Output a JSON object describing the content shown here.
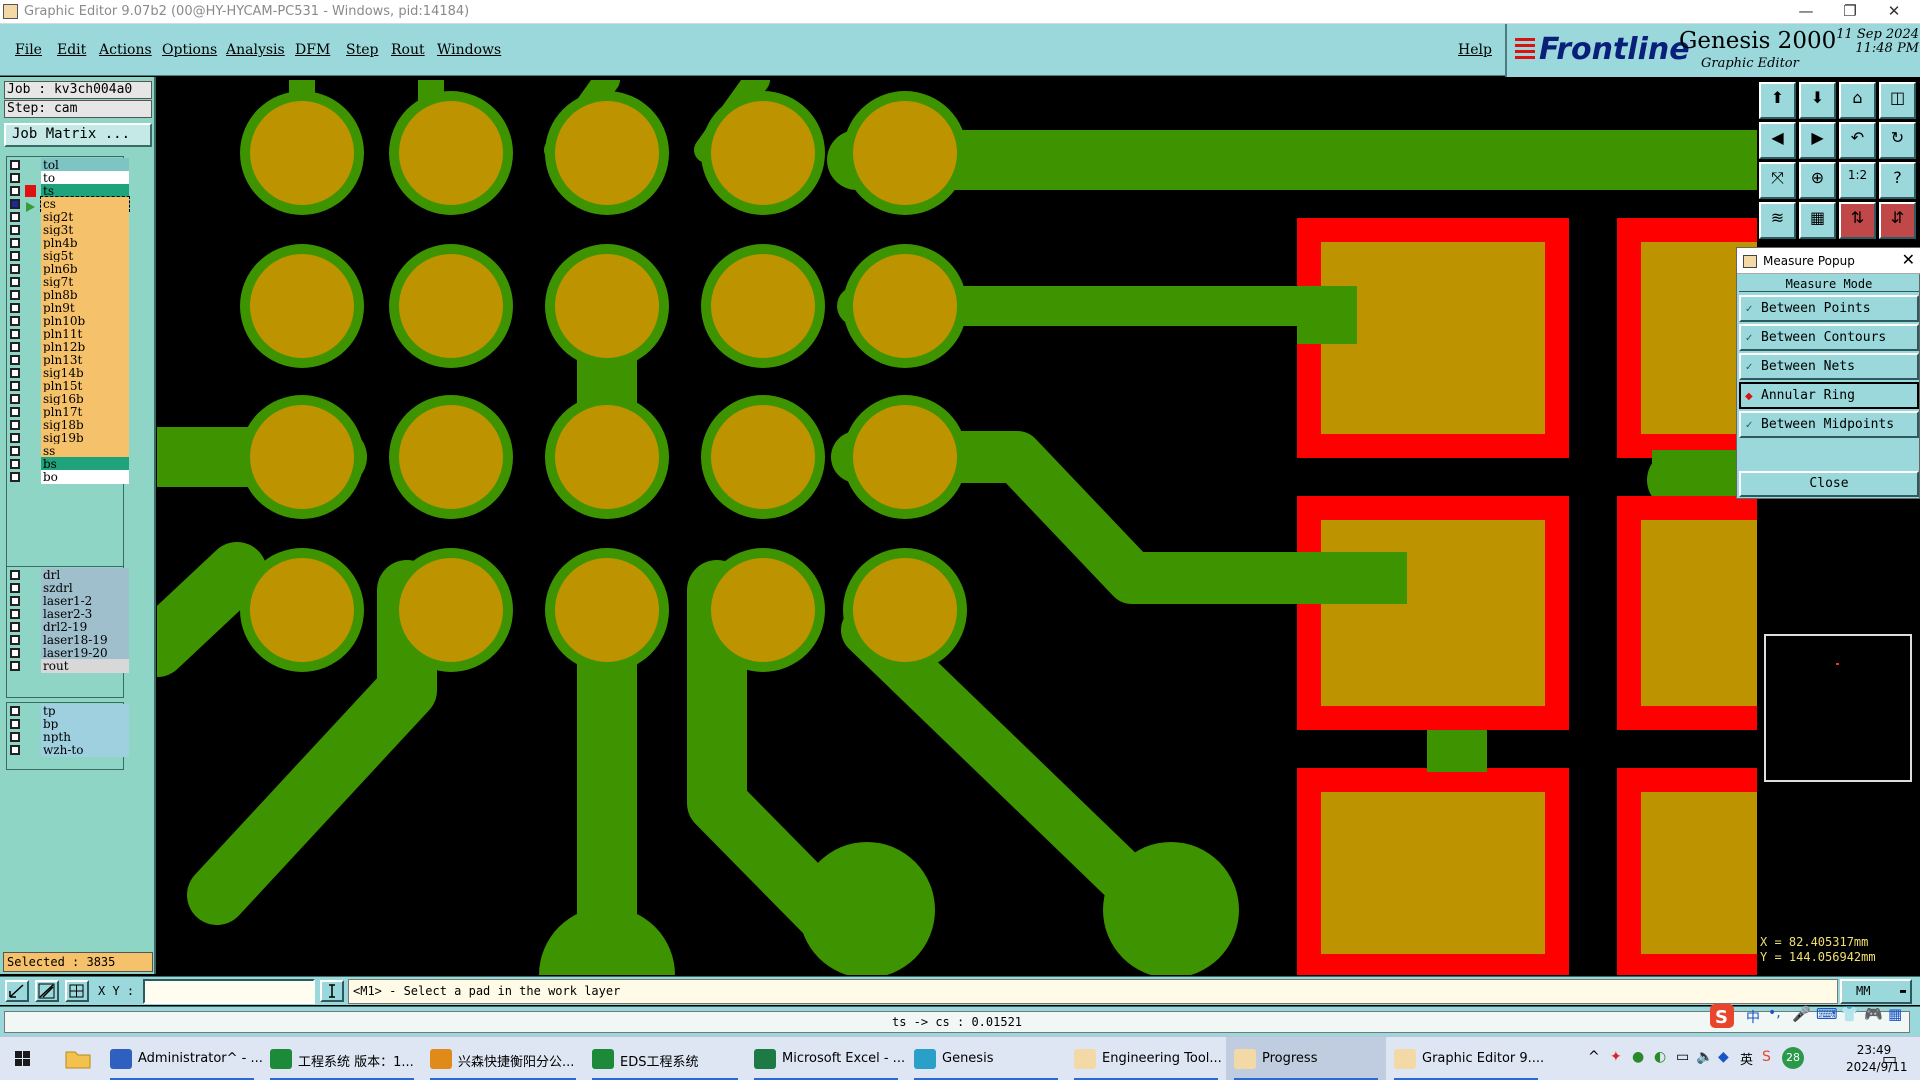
{
  "window": {
    "title": "Graphic Editor 9.07b2 (00@HY-HYCAM-PC531 - Windows, pid:14184)",
    "controls": [
      "—",
      "❐",
      "✕"
    ]
  },
  "menu": {
    "items": [
      "File",
      "Edit",
      "Actions",
      "Options",
      "Analysis",
      "DFM",
      "Step",
      "Rout",
      "Windows"
    ],
    "help": "Help"
  },
  "brand": {
    "logo": "Frontline",
    "product": "Genesis 2000",
    "subtitle": "Graphic Editor",
    "date": "11 Sep 2024",
    "time": "11:48 PM"
  },
  "job": {
    "job_line": "Job : kv3ch004a0",
    "step_line": "Step: cam",
    "matrix_button": "Job Matrix ..."
  },
  "layers": {
    "board": [
      {
        "name": "tol",
        "color": "#7ec4c4",
        "checked": false
      },
      {
        "name": "to",
        "color": "#ffffff",
        "checked": false
      },
      {
        "name": "ts",
        "color": "#1fa37c",
        "checked": false
      },
      {
        "name": "cs",
        "color": "#f5c16a",
        "checked": true,
        "selected": true
      },
      {
        "name": "sig2t",
        "color": "#f5c16a",
        "checked": false
      },
      {
        "name": "sig3t",
        "color": "#f5c16a",
        "checked": false
      },
      {
        "name": "pln4b",
        "color": "#f5c16a",
        "checked": false
      },
      {
        "name": "sig5t",
        "color": "#f5c16a",
        "checked": false
      },
      {
        "name": "pln6b",
        "color": "#f5c16a",
        "checked": false
      },
      {
        "name": "sig7t",
        "color": "#f5c16a",
        "checked": false
      },
      {
        "name": "pln8b",
        "color": "#f5c16a",
        "checked": false
      },
      {
        "name": "pln9t",
        "color": "#f5c16a",
        "checked": false
      },
      {
        "name": "pln10b",
        "color": "#f5c16a",
        "checked": false
      },
      {
        "name": "pln11t",
        "color": "#f5c16a",
        "checked": false
      },
      {
        "name": "pln12b",
        "color": "#f5c16a",
        "checked": false
      },
      {
        "name": "pln13t",
        "color": "#f5c16a",
        "checked": false
      },
      {
        "name": "sig14b",
        "color": "#f5c16a",
        "checked": false
      },
      {
        "name": "pln15t",
        "color": "#f5c16a",
        "checked": false
      },
      {
        "name": "sig16b",
        "color": "#f5c16a",
        "checked": false
      },
      {
        "name": "pln17t",
        "color": "#f5c16a",
        "checked": false
      },
      {
        "name": "sig18b",
        "color": "#f5c16a",
        "checked": false
      },
      {
        "name": "sig19b",
        "color": "#f5c16a",
        "checked": false
      },
      {
        "name": "ss",
        "color": "#f5c16a",
        "checked": false
      },
      {
        "name": "bs",
        "color": "#1fa37c",
        "checked": false
      },
      {
        "name": "bo",
        "color": "#ffffff",
        "checked": false
      }
    ],
    "drill": [
      {
        "name": "drl",
        "color": "#9fbfcc"
      },
      {
        "name": "szdrl",
        "color": "#9fbfcc"
      },
      {
        "name": "laser1-2",
        "color": "#9fbfcc"
      },
      {
        "name": "laser2-3",
        "color": "#9fbfcc"
      },
      {
        "name": "drl2-19",
        "color": "#9fbfcc"
      },
      {
        "name": "laser18-19",
        "color": "#9fbfcc"
      },
      {
        "name": "laser19-20",
        "color": "#9fbfcc"
      },
      {
        "name": "rout",
        "color": "#d8d8d8"
      }
    ],
    "misc": [
      {
        "name": "tp",
        "color": "#9fd0e0"
      },
      {
        "name": "bp",
        "color": "#9fd0e0"
      },
      {
        "name": "npth",
        "color": "#9fd0e0"
      },
      {
        "name": "wzh-to",
        "color": "#9fd0e0"
      }
    ]
  },
  "selected_count": "Selected : 3835",
  "measure_popup": {
    "title": "Measure Popup",
    "mode_header": "Measure Mode",
    "options": [
      "Between Points",
      "Between Contours",
      "Between Nets",
      "Annular Ring",
      "Between Midpoints"
    ],
    "active_option": "Annular Ring",
    "close": "Close"
  },
  "coords": {
    "x": "X = 82.405317mm",
    "y": "Y = 144.056942mm"
  },
  "command_bar": {
    "xy_label": "X Y :",
    "xy_value": "",
    "prompt": "<M1> - Select a pad in the work layer",
    "unit": "MM"
  },
  "status_text": "ts -> cs : 0.01521",
  "ime": {
    "lang": "中",
    "mode": "英"
  },
  "taskbar": {
    "items": [
      {
        "label": "Administrator^ - ...",
        "color": "#2f5fbf"
      },
      {
        "label": "工程系统  版本：1...",
        "color": "#1d8a3a"
      },
      {
        "label": "兴森快捷衡阳分公...",
        "color": "#e08a1a"
      },
      {
        "label": "EDS工程系统",
        "color": "#1d8a3a"
      },
      {
        "label": "Microsoft Excel - ...",
        "color": "#1d7a45"
      },
      {
        "label": "Genesis",
        "color": "#2aa0c8"
      },
      {
        "label": "Engineering Tool...",
        "color": "#f3d9a6"
      },
      {
        "label": "Progress",
        "color": "#f3d9a6"
      },
      {
        "label": "Graphic Editor 9....",
        "color": "#f3d9a6"
      }
    ],
    "active_index": 7,
    "tray_badge": "28",
    "tray_lang": "英",
    "clock_time": "23:49",
    "clock_date": "2024/9/11"
  },
  "board_colors": {
    "pad": "#bd9300",
    "trace": "#3d9300",
    "outline": "#ff0000",
    "background": "#000000"
  }
}
